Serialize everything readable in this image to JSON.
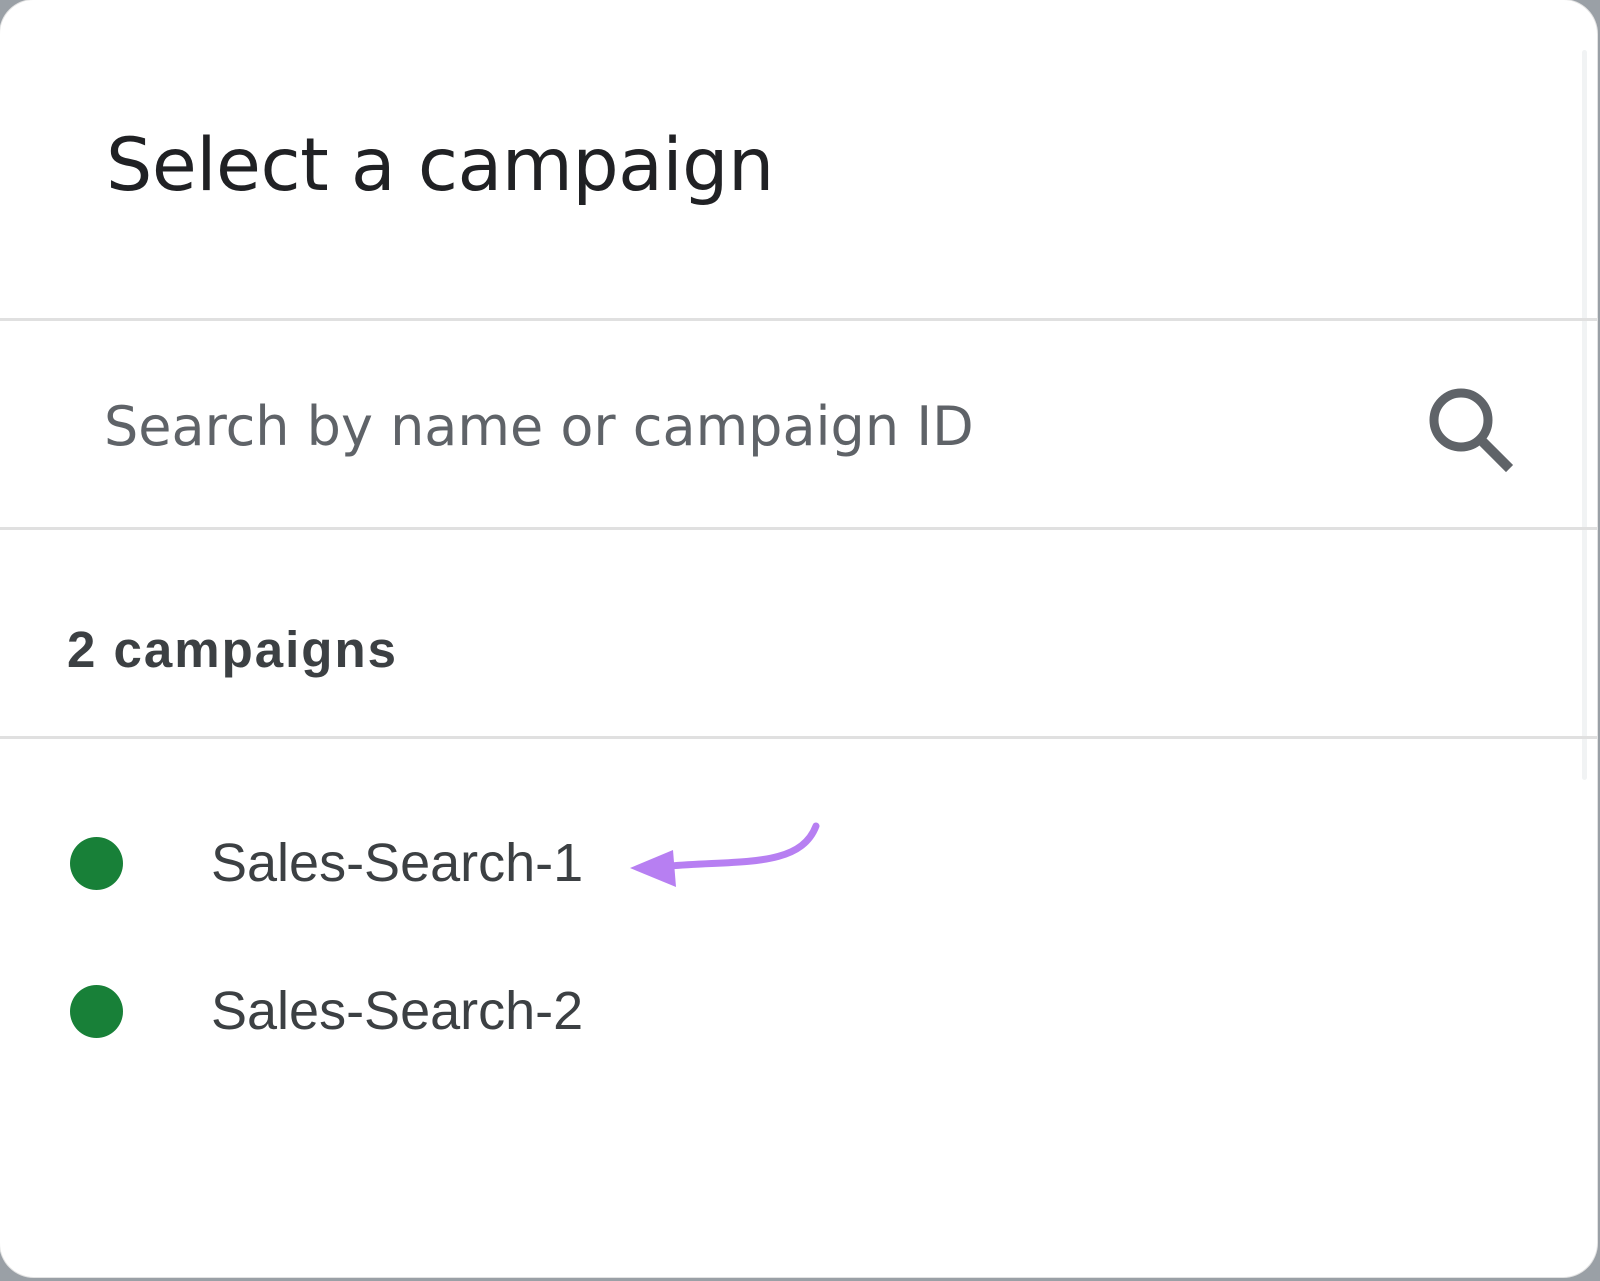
{
  "dialog": {
    "title": "Select a campaign"
  },
  "search": {
    "placeholder": "Search by name or campaign ID",
    "value": "",
    "icon": "search-icon"
  },
  "results": {
    "count_label": "2 campaigns",
    "items": [
      {
        "name": "Sales-Search-1",
        "status": "enabled",
        "status_color": "#188038"
      },
      {
        "name": "Sales-Search-2",
        "status": "enabled",
        "status_color": "#188038"
      }
    ]
  },
  "annotation": {
    "icon": "arrow-annotation-icon",
    "color": "#b77ff2"
  },
  "colors": {
    "text_primary": "#202124",
    "text_secondary": "#3c4043",
    "placeholder": "#5f6368",
    "divider": "#e0e0e0",
    "status_enabled": "#188038"
  }
}
